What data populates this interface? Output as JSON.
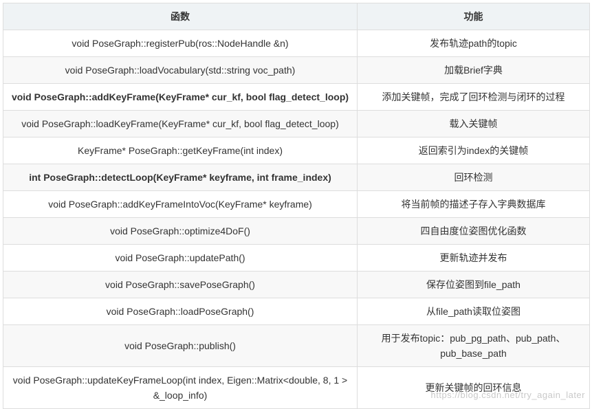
{
  "header": {
    "col1": "函数",
    "col2": "功能"
  },
  "rows": [
    {
      "func": "void PoseGraph::registerPub(ros::NodeHandle &n)",
      "desc": "发布轨迹path的topic"
    },
    {
      "func": "void PoseGraph::loadVocabulary(std::string voc_path)",
      "desc": "加载Brief字典"
    },
    {
      "func": "void PoseGraph::addKeyFrame(KeyFrame* cur_kf, bool flag_detect_loop)",
      "desc": "添加关键帧，完成了回环检测与闭环的过程"
    },
    {
      "func": "void PoseGraph::loadKeyFrame(KeyFrame* cur_kf, bool flag_detect_loop)",
      "desc": "载入关键帧"
    },
    {
      "func": "KeyFrame* PoseGraph::getKeyFrame(int index)",
      "desc": "返回索引为index的关键帧"
    },
    {
      "func": "int PoseGraph::detectLoop(KeyFrame* keyframe, int frame_index)",
      "desc": "回环检测"
    },
    {
      "func": "void PoseGraph::addKeyFrameIntoVoc(KeyFrame* keyframe)",
      "desc": "将当前帧的描述子存入字典数据库"
    },
    {
      "func": "void PoseGraph::optimize4DoF()",
      "desc": "四自由度位姿图优化函数"
    },
    {
      "func": "void PoseGraph::updatePath()",
      "desc": "更新轨迹并发布"
    },
    {
      "func": "void PoseGraph::savePoseGraph()",
      "desc": "保存位姿图到file_path"
    },
    {
      "func": "void PoseGraph::loadPoseGraph()",
      "desc": "从file_path读取位姿图"
    },
    {
      "func": "void PoseGraph::publish()",
      "desc": "用于发布topic：pub_pg_path、pub_path、pub_base_path"
    },
    {
      "func": "void PoseGraph::updateKeyFrameLoop(int index, Eigen::Matrix<double, 8, 1 > &_loop_info)",
      "desc": "更新关键帧的回环信息"
    }
  ],
  "watermark": "https://blog.csdn.net/try_again_later"
}
